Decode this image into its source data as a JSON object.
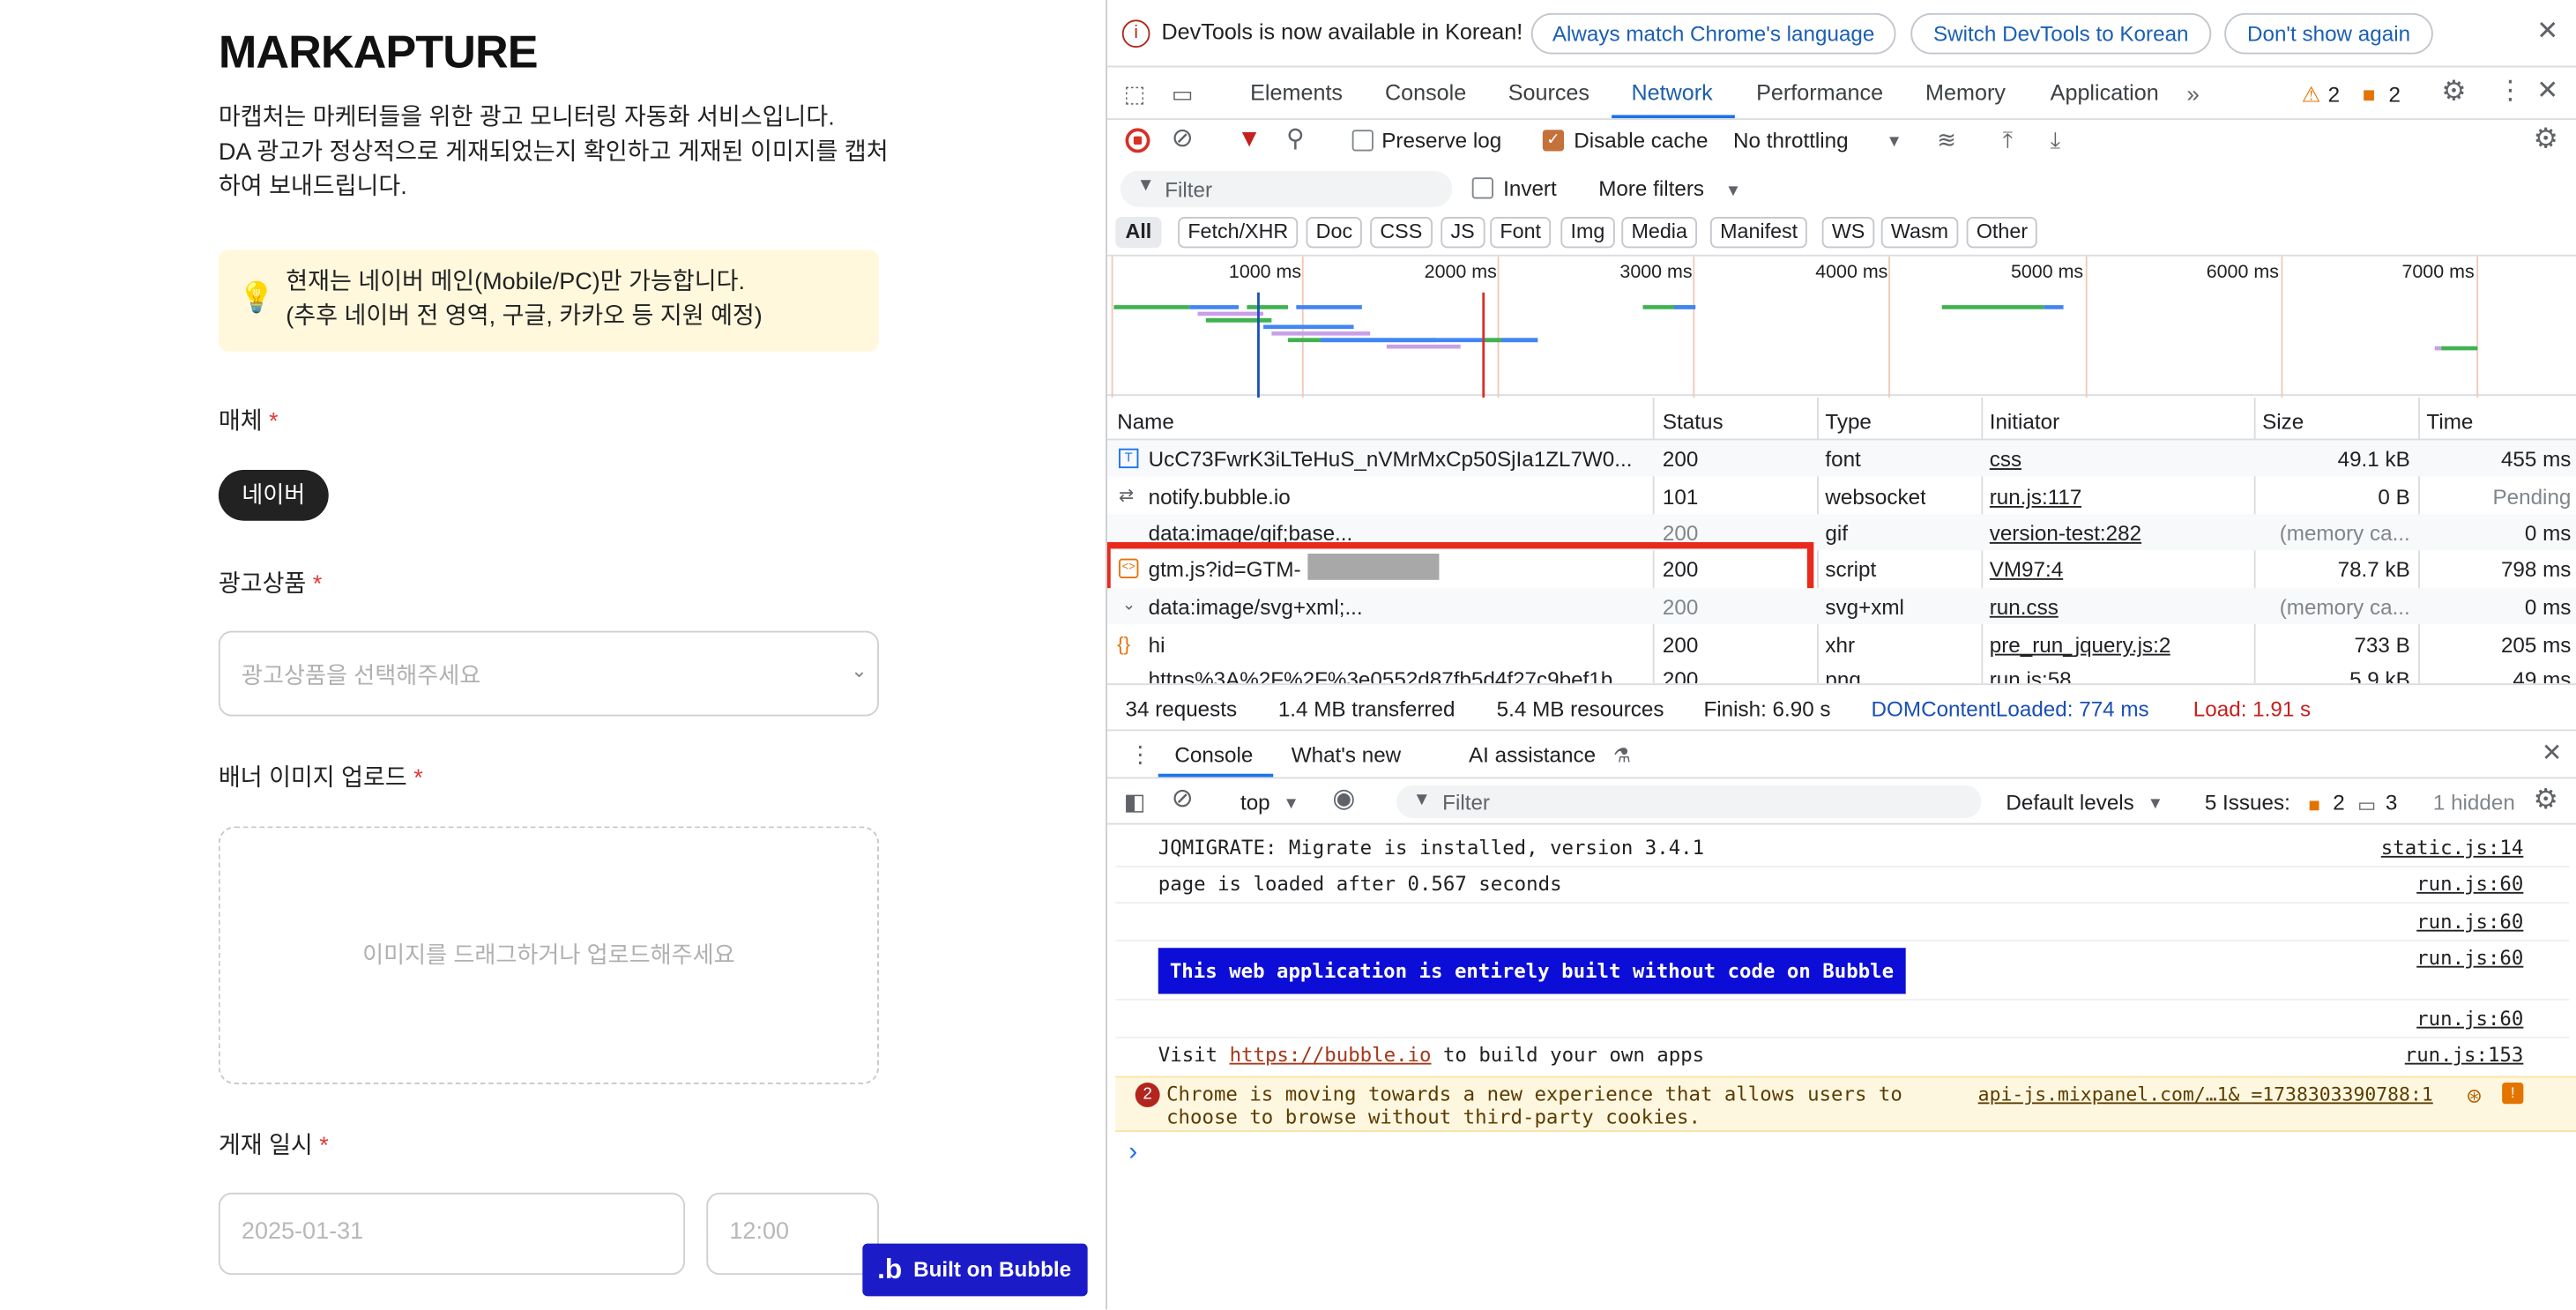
{
  "app": {
    "logo": "MARKAPTURE",
    "intro": [
      "마캡처는 마케터들을 위한 광고 모니터링 자동화 서비스입니다.",
      "DA 광고가 정상적으로 게재되었는지 확인하고 게재된 이미지를 캡처",
      "하여 보내드립니다."
    ],
    "notice": [
      "현재는 네이버 메인(Mobile/PC)만 가능합니다.",
      "(추후 네이버 전 영역, 구글, 카카오 등 지원 예정)"
    ],
    "media_label": "매체",
    "required_mark": "*",
    "media_chip": "네이버",
    "product_label": "광고상품",
    "product_placeholder": "광고상품을 선택해주세요",
    "upload_label": "배너 이미지 업로드",
    "upload_placeholder": "이미지를 드래그하거나 업로드해주세요",
    "date_label": "게재 일시",
    "date_placeholder": "2025-01-31",
    "time_placeholder": "12:00",
    "built_on": "Built on Bubble"
  },
  "devtools": {
    "banner": {
      "text": "DevTools is now available in Korean!",
      "btn1": "Always match Chrome's language",
      "btn2": "Switch DevTools to Korean",
      "btn3": "Don't show again"
    },
    "tabs": [
      "Elements",
      "Console",
      "Sources",
      "Network",
      "Performance",
      "Memory",
      "Application"
    ],
    "active_tab": "Network",
    "warn_count": "2",
    "err_count": "2",
    "toolbar": {
      "preserve_log": "Preserve log",
      "disable_cache": "Disable cache",
      "throttling": "No throttling"
    },
    "filter": {
      "placeholder": "Filter",
      "invert": "Invert",
      "more_filters": "More filters"
    },
    "type_filters": [
      "All",
      "Fetch/XHR",
      "Doc",
      "CSS",
      "JS",
      "Font",
      "Img",
      "Media",
      "Manifest",
      "WS",
      "Wasm",
      "Other"
    ],
    "timeline_ticks": [
      "1000 ms",
      "2000 ms",
      "3000 ms",
      "4000 ms",
      "5000 ms",
      "6000 ms",
      "7000 ms"
    ],
    "columns": [
      "Name",
      "Status",
      "Type",
      "Initiator",
      "Size",
      "Time"
    ],
    "requests": [
      {
        "name": "UcC73FwrK3iLTeHuS_nVMrMxCp50SjIa1ZL7W0...",
        "status": "200",
        "type": "font",
        "initiator": "css",
        "size": "49.1 kB",
        "time": "455 ms"
      },
      {
        "name": "notify.bubble.io",
        "status": "101",
        "type": "websocket",
        "initiator": "run.js:117",
        "size": "0 B",
        "time": "Pending"
      },
      {
        "name": "data:image/gif;base...",
        "status": "200",
        "type": "gif",
        "initiator": "version-test:282",
        "size": "(memory ca...",
        "time": "0 ms"
      },
      {
        "name": "gtm.js?id=GTM-",
        "status": "200",
        "type": "script",
        "initiator": "VM97:4",
        "size": "78.7 kB",
        "time": "798 ms"
      },
      {
        "name": "data:image/svg+xml;...",
        "status": "200",
        "type": "svg+xml",
        "initiator": "run.css",
        "size": "(memory ca...",
        "time": "0 ms"
      },
      {
        "name": "hi",
        "status": "200",
        "type": "xhr",
        "initiator": "pre_run_jquery.js:2",
        "size": "733 B",
        "time": "205 ms"
      },
      {
        "name": "https%3A%2F%2F%3e0552d87fb5d4f27c9bef1b...",
        "status": "200",
        "type": "png",
        "initiator": "run.js:58",
        "size": "5.9 kB",
        "time": "49 ms"
      }
    ],
    "summary": {
      "requests": "34 requests",
      "transferred": "1.4 MB transferred",
      "resources": "5.4 MB resources",
      "finish": "Finish: 6.90 s",
      "dcl": "DOMContentLoaded: 774 ms",
      "load": "Load: 1.91 s"
    },
    "drawer_tabs": [
      "Console",
      "What's new",
      "AI assistance"
    ],
    "console_toolbar": {
      "context": "top",
      "filter": "Filter",
      "levels": "Default levels",
      "issues_label": "5 Issues:",
      "issues_warn": "2",
      "issues_info": "3",
      "hidden": "1 hidden"
    },
    "console": {
      "l1": "JQMIGRATE: Migrate is installed, version 3.4.1",
      "s1": "static.js:14",
      "l2": "page is loaded after 0.567 seconds",
      "s2": "run.js:60",
      "s3": "run.js:60",
      "l4": "This web application is entirely built without code on Bubble",
      "s4": "run.js:60",
      "s5": "run.js:60",
      "l6a": "Visit ",
      "l6link": "https://bubble.io",
      "l6b": " to build your own apps",
      "s6": "run.js:153",
      "warn_count": "2",
      "l7a": "Chrome is moving towards a new experience that allows users to",
      "l7b": "choose to browse without third-party cookies.",
      "s7": "api-js.mixpanel.com/…1& =1738303390788:1",
      "prompt": "›"
    }
  }
}
